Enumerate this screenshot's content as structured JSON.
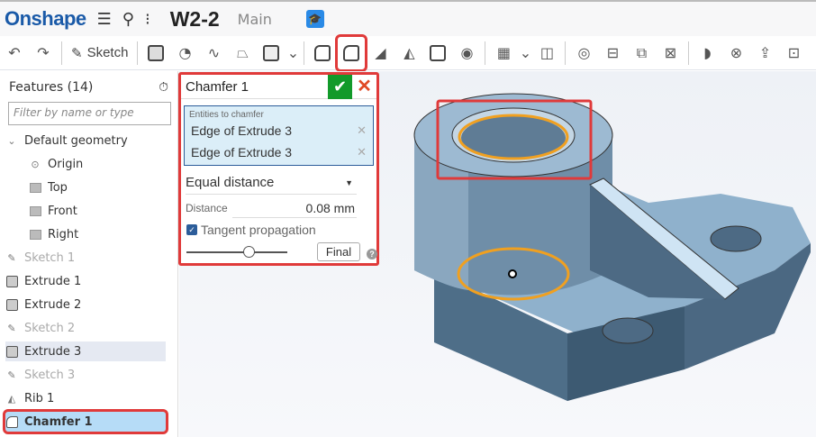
{
  "app": {
    "logo": "Onshape",
    "doc_title": "W2-2",
    "branch": "Main"
  },
  "toolbar": {
    "sketch_label": "Sketch"
  },
  "sidebar": {
    "title": "Features (14)",
    "filter_placeholder": "Filter by name or type",
    "items": [
      {
        "label": "Default geometry",
        "type": "group"
      },
      {
        "label": "Origin",
        "type": "origin"
      },
      {
        "label": "Top",
        "type": "plane"
      },
      {
        "label": "Front",
        "type": "plane"
      },
      {
        "label": "Right",
        "type": "plane"
      },
      {
        "label": "Sketch 1",
        "type": "sketch"
      },
      {
        "label": "Extrude 1",
        "type": "extrude"
      },
      {
        "label": "Extrude 2",
        "type": "extrude"
      },
      {
        "label": "Sketch 2",
        "type": "sketch"
      },
      {
        "label": "Extrude 3",
        "type": "extrude"
      },
      {
        "label": "Sketch 3",
        "type": "sketch"
      },
      {
        "label": "Rib 1",
        "type": "rib"
      },
      {
        "label": "Chamfer 1",
        "type": "chamfer"
      }
    ]
  },
  "panel": {
    "title": "Chamfer 1",
    "entities_label": "Entities to chamfer",
    "entities": [
      "Edge of Extrude 3",
      "Edge of Extrude 3"
    ],
    "type": "Equal distance",
    "distance_label": "Distance",
    "distance": "0.08 mm",
    "tangent_label": "Tangent propagation",
    "tangent_checked": true,
    "slider_value": 0.62,
    "final_label": "Final"
  },
  "colors": {
    "accent": "#1a5aa8",
    "highlight": "#e03a3a",
    "ok": "#129a2a",
    "model": "#7d9bb5",
    "annotation": "#f0a020"
  }
}
